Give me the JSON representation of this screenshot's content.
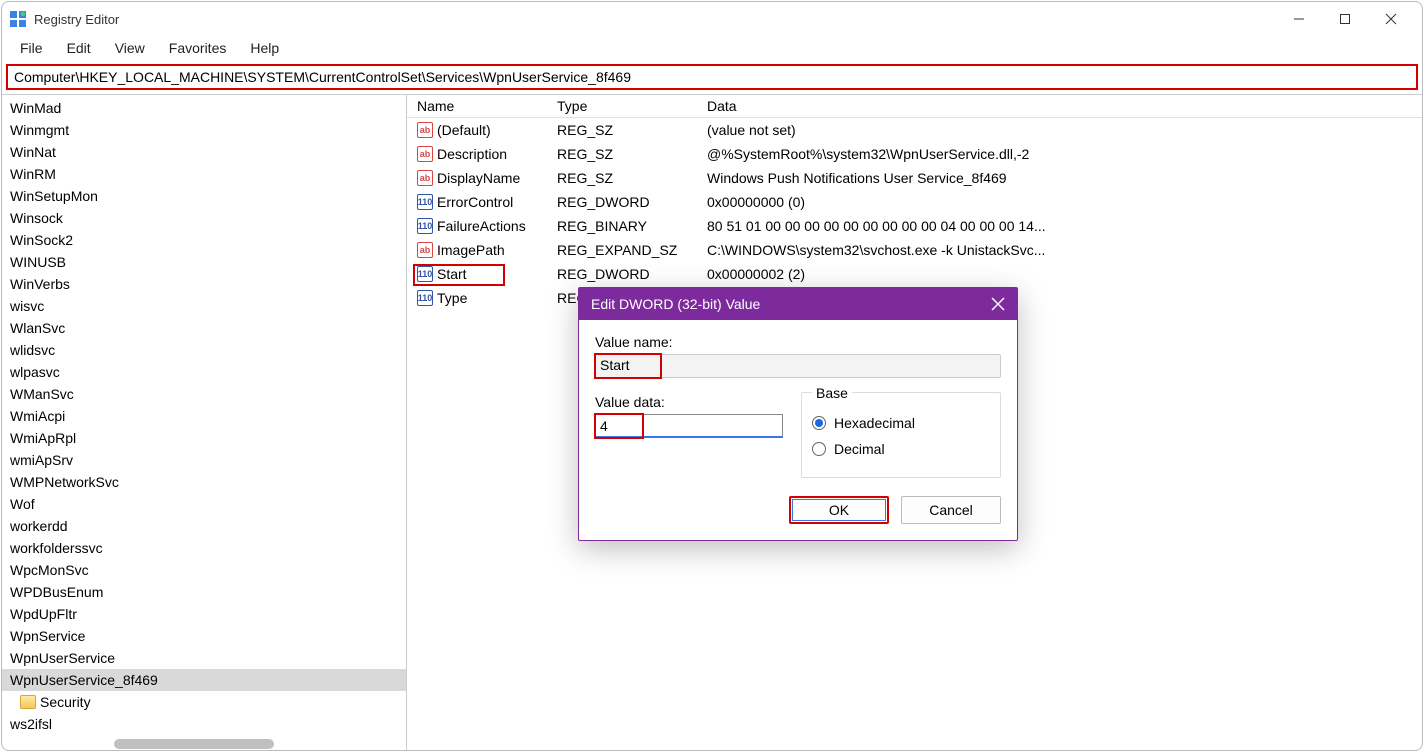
{
  "window": {
    "title": "Registry Editor"
  },
  "menu": {
    "file": "File",
    "edit": "Edit",
    "view": "View",
    "favorites": "Favorites",
    "help": "Help"
  },
  "address": "Computer\\HKEY_LOCAL_MACHINE\\SYSTEM\\CurrentControlSet\\Services\\WpnUserService_8f469",
  "tree": {
    "items": [
      "WinMad",
      "Winmgmt",
      "WinNat",
      "WinRM",
      "WinSetupMon",
      "Winsock",
      "WinSock2",
      "WINUSB",
      "WinVerbs",
      "wisvc",
      "WlanSvc",
      "wlidsvc",
      "wlpasvc",
      "WManSvc",
      "WmiAcpi",
      "WmiApRpl",
      "wmiApSrv",
      "WMPNetworkSvc",
      "Wof",
      "workerdd",
      "workfolderssvc",
      "WpcMonSvc",
      "WPDBusEnum",
      "WpdUpFltr",
      "WpnService",
      "WpnUserService",
      "WpnUserService_8f469",
      "Security",
      "ws2ifsl"
    ]
  },
  "columns": {
    "name": "Name",
    "type": "Type",
    "data": "Data"
  },
  "values": [
    {
      "icon": "sz",
      "name": "(Default)",
      "type": "REG_SZ",
      "data": "(value not set)"
    },
    {
      "icon": "sz",
      "name": "Description",
      "type": "REG_SZ",
      "data": "@%SystemRoot%\\system32\\WpnUserService.dll,-2"
    },
    {
      "icon": "sz",
      "name": "DisplayName",
      "type": "REG_SZ",
      "data": "Windows Push Notifications User Service_8f469"
    },
    {
      "icon": "bin",
      "name": "ErrorControl",
      "type": "REG_DWORD",
      "data": "0x00000000 (0)"
    },
    {
      "icon": "bin",
      "name": "FailureActions",
      "type": "REG_BINARY",
      "data": "80 51 01 00 00 00 00 00 00 00 00 00 04 00 00 00 14..."
    },
    {
      "icon": "sz",
      "name": "ImagePath",
      "type": "REG_EXPAND_SZ",
      "data": "C:\\WINDOWS\\system32\\svchost.exe -k UnistackSvc..."
    },
    {
      "icon": "bin",
      "name": "Start",
      "type": "REG_DWORD",
      "data": "0x00000002 (2)"
    },
    {
      "icon": "bin",
      "name": "Type",
      "type": "REG_",
      "data": ""
    }
  ],
  "dialog": {
    "title": "Edit DWORD (32-bit) Value",
    "value_name_label": "Value name:",
    "value_name": "Start",
    "value_data_label": "Value data:",
    "value_data": "4",
    "base_label": "Base",
    "hex_label": "Hexadecimal",
    "dec_label": "Decimal",
    "ok": "OK",
    "cancel": "Cancel"
  },
  "icons": {
    "sz_text": "ab",
    "bin_text": "110"
  }
}
